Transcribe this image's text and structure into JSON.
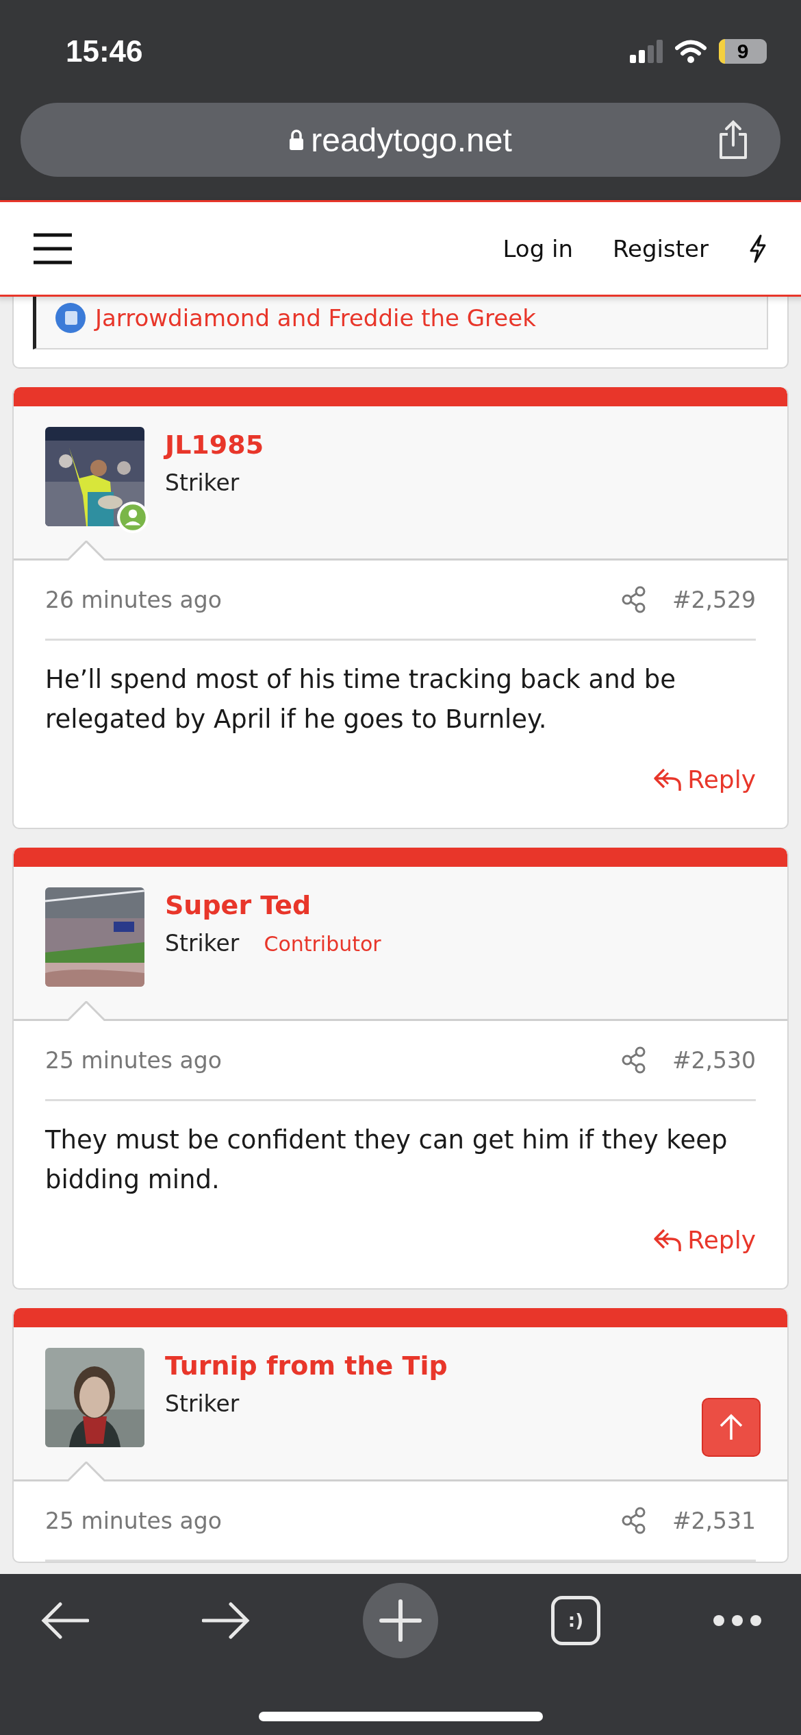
{
  "status_bar": {
    "time": "15:46",
    "battery": "9"
  },
  "address_bar": {
    "url": "readytogo.net"
  },
  "site_header": {
    "links": [
      "Log in",
      "Register"
    ]
  },
  "quote": {
    "text": "Jarrowdiamond and Freddie the Greek"
  },
  "posts": [
    {
      "author": "JL1985",
      "title": "Striker",
      "online": true,
      "time": "26 minutes ago",
      "number": "#2,529",
      "body": "He’ll spend most of his time tracking back and be relegated by April if he goes to Burnley.",
      "reply": "Reply"
    },
    {
      "author": "Super Ted",
      "title": "Striker",
      "badge": "Contributor",
      "online": false,
      "time": "25 minutes ago",
      "number": "#2,530",
      "body": "They must be confident they can get him if they keep bidding mind.",
      "reply": "Reply"
    },
    {
      "author": "Turnip from the Tip",
      "title": "Striker",
      "online": false,
      "time": "25 minutes ago",
      "number": "#2,531"
    }
  ],
  "toolbar": {
    "tabs_label": ":)"
  }
}
